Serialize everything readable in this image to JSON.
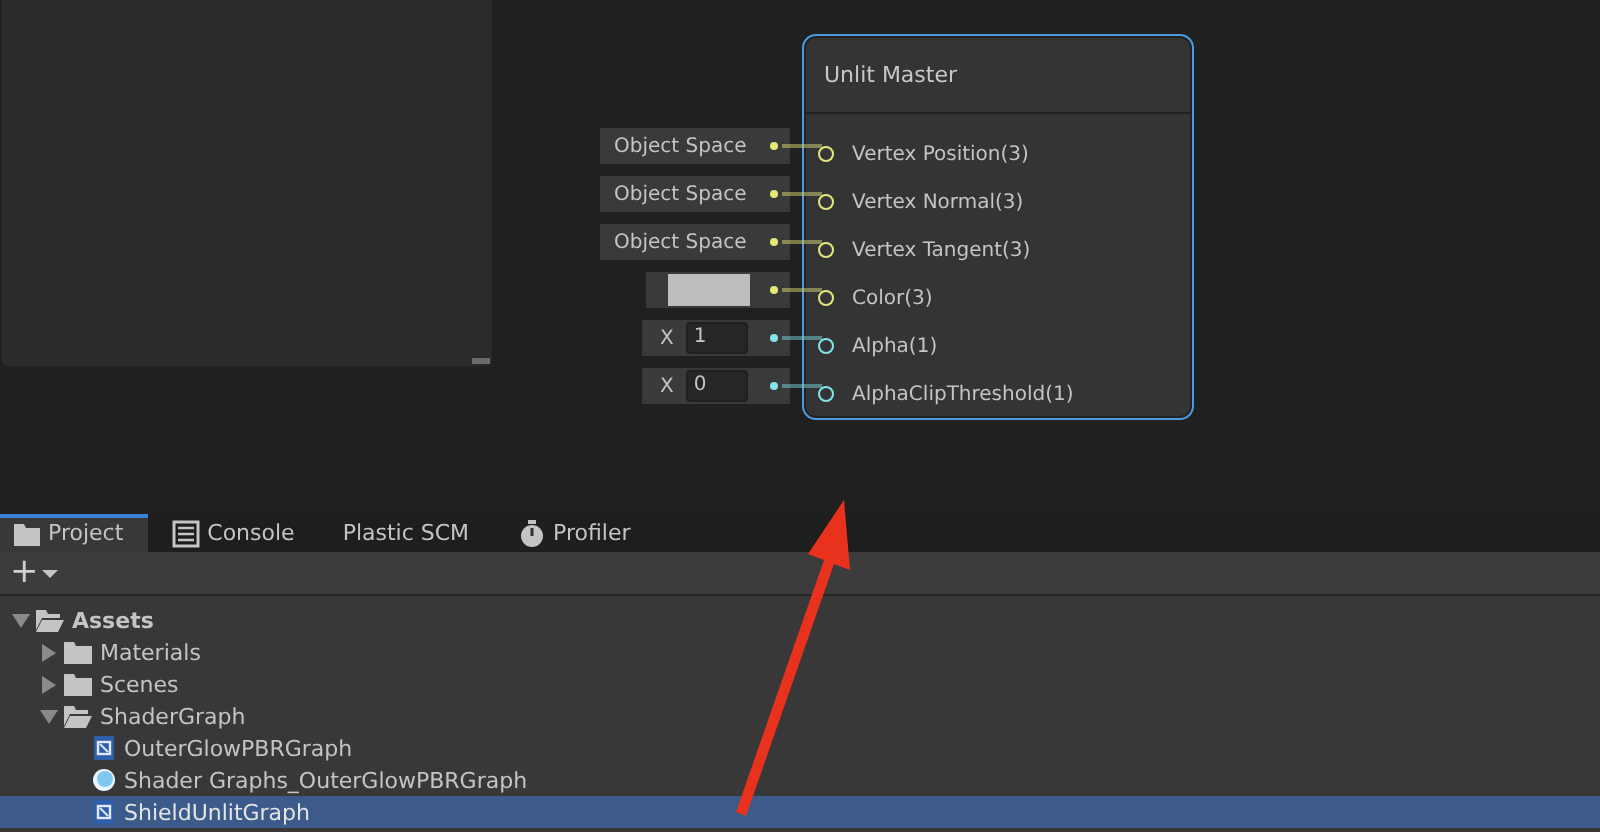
{
  "graph": {
    "node": {
      "title": "Unlit Master",
      "ports": [
        {
          "label": "Vertex Position(3)",
          "color": "#e8e87a",
          "input": {
            "kind": "dropdown",
            "text": "Object Space"
          }
        },
        {
          "label": "Vertex Normal(3)",
          "color": "#e8e87a",
          "input": {
            "kind": "dropdown",
            "text": "Object Space"
          }
        },
        {
          "label": "Vertex Tangent(3)",
          "color": "#e8e87a",
          "input": {
            "kind": "dropdown",
            "text": "Object Space"
          }
        },
        {
          "label": "Color(3)",
          "color": "#e8e87a",
          "input": {
            "kind": "color",
            "color": "#bdbdbd"
          }
        },
        {
          "label": "Alpha(1)",
          "color": "#84e4e7",
          "input": {
            "kind": "number",
            "axis": "X",
            "value": "1"
          }
        },
        {
          "label": "AlphaClipThreshold(1)",
          "color": "#84e4e7",
          "input": {
            "kind": "number",
            "axis": "X",
            "value": "0"
          }
        }
      ]
    }
  },
  "tabs": [
    {
      "label": "Project",
      "kind": "folder",
      "selected": true
    },
    {
      "label": "Console",
      "kind": "console",
      "selected": false
    },
    {
      "label": "Plastic SCM",
      "selected": false
    },
    {
      "label": "Profiler",
      "kind": "stopwatch",
      "selected": false
    }
  ],
  "toolbar": {
    "add": "+"
  },
  "tree": [
    {
      "label": "Assets",
      "kind": "folder",
      "expanded": true,
      "selected": false,
      "children": [
        {
          "label": "Materials",
          "kind": "folder",
          "expanded": false,
          "selected": false
        },
        {
          "label": "Scenes",
          "kind": "folder",
          "expanded": false,
          "selected": false
        },
        {
          "label": "ShaderGraph",
          "kind": "folder",
          "expanded": true,
          "selected": false,
          "children": [
            {
              "label": "OuterGlowPBRGraph",
              "kind": "shadergraph",
              "selected": false
            },
            {
              "label": "Shader Graphs_OuterGlowPBRGraph",
              "kind": "material",
              "selected": false
            },
            {
              "label": "ShieldUnlitGraph",
              "kind": "shadergraph",
              "selected": true
            }
          ]
        }
      ]
    }
  ]
}
